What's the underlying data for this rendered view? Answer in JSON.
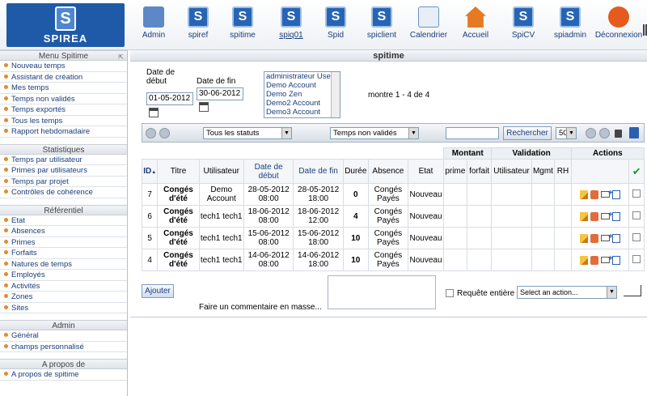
{
  "logo": {
    "text": "SPIREA"
  },
  "nav": [
    {
      "label": "Admin",
      "icon": "admin-icon",
      "underline": false
    },
    {
      "label": "spiref",
      "icon": "spirea-icon",
      "underline": false
    },
    {
      "label": "spitime",
      "icon": "spirea-icon",
      "underline": false
    },
    {
      "label": "spiq01",
      "icon": "spirea-icon",
      "underline": true
    },
    {
      "label": "Spid",
      "icon": "spirea-icon",
      "underline": false
    },
    {
      "label": "spiclient",
      "icon": "spirea-icon",
      "underline": false
    },
    {
      "label": "Calendrier",
      "icon": "calendar-icon",
      "underline": false
    },
    {
      "label": "Accueil",
      "icon": "home-icon",
      "underline": false
    },
    {
      "label": "SpiCV",
      "icon": "spirea-icon",
      "underline": false
    },
    {
      "label": "spiadmin",
      "icon": "spirea-icon",
      "underline": false
    },
    {
      "label": "Déconnexion",
      "icon": "power-icon",
      "underline": false
    }
  ],
  "sidebar": {
    "menu_title": "Menu Spitime",
    "menu_items": [
      "Nouveau temps",
      "Assistant de création",
      "Mes temps",
      "Temps non validés",
      "Temps exportés",
      "Tous les temps",
      "Rapport hebdomadaire"
    ],
    "stats_title": "Statistiques",
    "stats_items": [
      "Temps par utilisateur",
      "Primes par utilisateurs",
      "Temps par projet",
      "Contrôles de cohérence"
    ],
    "ref_title": "Référentiel",
    "ref_items": [
      "Etat",
      "Absences",
      "Primes",
      "Forfaits",
      "Natures de temps",
      "Employés",
      "Activités",
      "Zones",
      "Sites"
    ],
    "admin_title": "Admin",
    "admin_items": [
      "Général",
      "champs personnalisé"
    ],
    "about_title": "A propos de",
    "about_items": [
      "A propos de spitime"
    ]
  },
  "page": {
    "title": "spitime"
  },
  "filters": {
    "start_label": "Date de début",
    "start_value": "01-05-2012",
    "end_label": "Date de fin",
    "end_value": "30-06-2012",
    "users": [
      "administrateur User",
      "Demo Account",
      "Demo Zen",
      "Demo2 Account",
      "Demo3 Account"
    ],
    "count_text": "montre 1 - 4 de 4"
  },
  "toolbar": {
    "status_select": "Tous les statuts",
    "type_select": "Temps non validés",
    "search_label": "Rechercher",
    "page_size": "50"
  },
  "table": {
    "group_headers": {
      "montant": "Montant",
      "validation": "Validation",
      "actions": "Actions"
    },
    "headers": [
      "ID",
      "Titre",
      "Utilisateur",
      "Date de début",
      "Date de fin",
      "Durée",
      "Absence",
      "Etat",
      "prime",
      "forfait",
      "Utilisateur",
      "Mgmt",
      "RH"
    ],
    "rows": [
      {
        "id": "7",
        "titre": "Congés d'été",
        "user": "Demo Account",
        "start": "28-05-2012 08:00",
        "end": "28-05-2012 18:00",
        "duree": "0",
        "absence": "Congés Payés",
        "etat": "Nouveau"
      },
      {
        "id": "6",
        "titre": "Congés d'été",
        "user": "tech1 tech1",
        "start": "18-06-2012 08:00",
        "end": "18-06-2012 12:00",
        "duree": "4",
        "absence": "Congés Payés",
        "etat": "Nouveau"
      },
      {
        "id": "5",
        "titre": "Congés d'été",
        "user": "tech1 tech1",
        "start": "15-06-2012 08:00",
        "end": "15-06-2012 18:00",
        "duree": "10",
        "absence": "Congés Payés",
        "etat": "Nouveau"
      },
      {
        "id": "4",
        "titre": "Congés d'été",
        "user": "tech1 tech1",
        "start": "14-06-2012 08:00",
        "end": "14-06-2012 18:00",
        "duree": "10",
        "absence": "Congés Payés",
        "etat": "Nouveau"
      }
    ]
  },
  "footer": {
    "add_label": "Ajouter",
    "mass_comment_label": "Faire un commentaire en masse...",
    "whole_request_label": "Requête entière",
    "action_select": "Select an action..."
  }
}
